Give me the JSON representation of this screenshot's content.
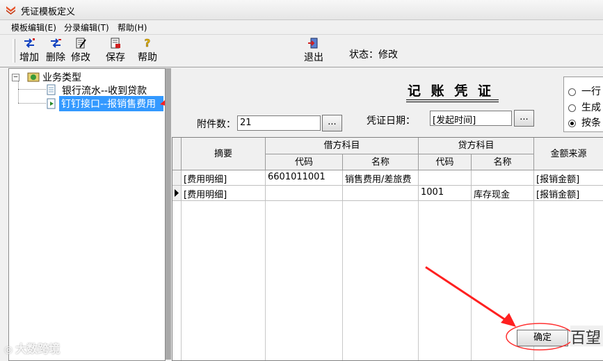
{
  "window": {
    "title": "凭证模板定义"
  },
  "menu": [
    {
      "label": "模板编辑(E)"
    },
    {
      "label": "分录编辑(T)"
    },
    {
      "label": "帮助(H)"
    }
  ],
  "toolbar": {
    "add": "增加",
    "delete": "删除",
    "edit": "修改",
    "save": "保存",
    "help": "帮助",
    "exit": "退出",
    "status": "状态：修改"
  },
  "tree": {
    "root": "业务类型",
    "items": [
      {
        "label": "银行流水--收到贷款"
      },
      {
        "label": "钉钉接口--报销售费用"
      }
    ]
  },
  "form": {
    "voucher_title": "记 账 凭 证",
    "attachments_label": "附件数：",
    "attachments_value": "21",
    "date_label": "凭证日期：",
    "date_value": "[发起时间]",
    "browse": "...",
    "radios": [
      {
        "label": "一行",
        "checked": false
      },
      {
        "label": "生成",
        "checked": false
      },
      {
        "label": "按条",
        "checked": true
      }
    ]
  },
  "grid": {
    "headers": {
      "summary": "摘要",
      "debit": "借方科目",
      "credit": "贷方科目",
      "code": "代码",
      "name": "名称",
      "amount_source": "金额来源"
    },
    "rows": [
      {
        "summary": "[费用明细]",
        "debit_code": "6601011001",
        "debit_name": "销售费用/差旅费",
        "credit_code": "",
        "credit_name": "",
        "amount_source": "[报销金额]"
      },
      {
        "summary": "[费用明细]",
        "debit_code": "",
        "debit_name": "",
        "credit_code": "1001",
        "credit_name": "库存现金",
        "amount_source": "[报销金额]"
      }
    ]
  },
  "confirm": "确定",
  "watermark": "大数跨境",
  "watermark_right": "百望"
}
